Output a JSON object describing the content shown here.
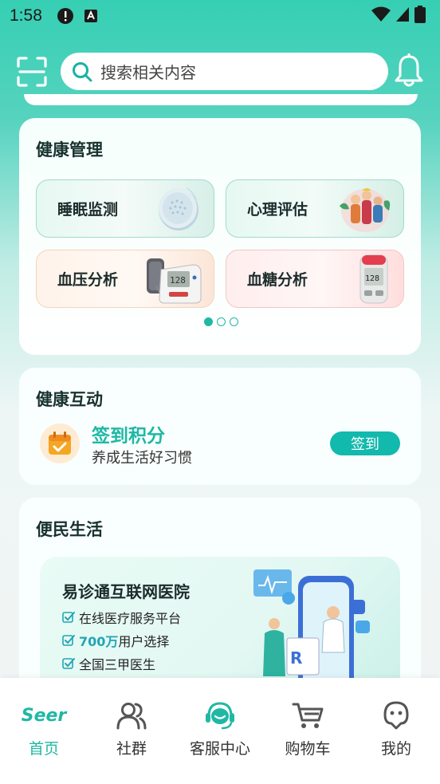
{
  "status_bar": {
    "time": "1:58"
  },
  "search": {
    "placeholder": "搜索相关内容"
  },
  "health": {
    "title": "健康管理",
    "tiles": [
      {
        "label": "睡眠监测"
      },
      {
        "label": "心理评估"
      },
      {
        "label": "血压分析"
      },
      {
        "label": "血糖分析"
      }
    ],
    "carousel": {
      "pages": 3,
      "current": 1
    }
  },
  "interact": {
    "title": "健康互动",
    "checkin_title": "签到积分",
    "checkin_sub": "养成生活好习惯",
    "checkin_button": "签到"
  },
  "life": {
    "title": "便民生活",
    "banner_title": "易诊通互联网医院",
    "features": [
      {
        "prefix": "",
        "highlight": "",
        "text": "在线医疗服务平台"
      },
      {
        "prefix": "",
        "highlight": "700万",
        "text": "用户选择"
      },
      {
        "prefix": "",
        "highlight": "",
        "text": "全国三甲医生"
      }
    ]
  },
  "tabbar": {
    "logo_text": "Seer",
    "items": [
      {
        "label": "首页",
        "icon": "seer-logo-icon",
        "active": true
      },
      {
        "label": "社群",
        "icon": "community-icon",
        "active": false
      },
      {
        "label": "客服中心",
        "icon": "customer-service-icon",
        "active": false
      },
      {
        "label": "购物车",
        "icon": "cart-icon",
        "active": false
      },
      {
        "label": "我的",
        "icon": "profile-icon",
        "active": false
      }
    ]
  },
  "colors": {
    "accent": "#1fb8a5",
    "header_gradient_top": "#36cfb4",
    "button": "#12b9ad"
  }
}
